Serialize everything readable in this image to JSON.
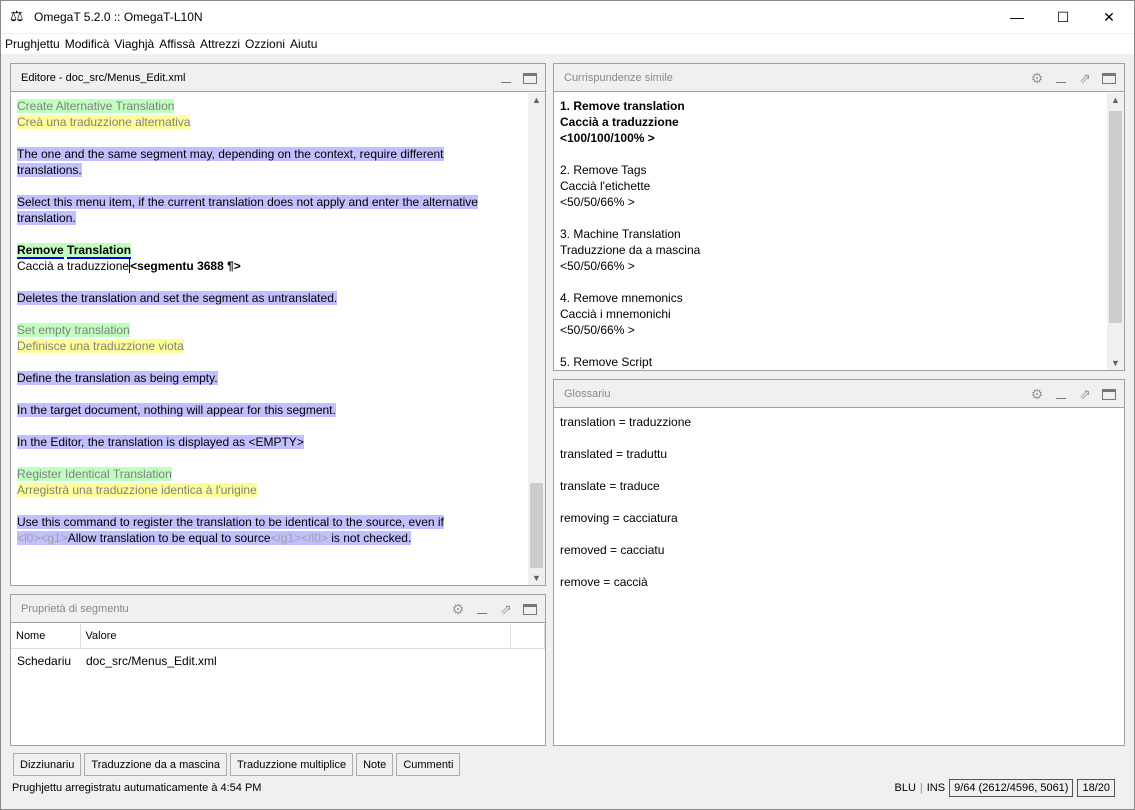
{
  "window": {
    "title": "OmegaT 5.2.0 :: OmegaT-L10N",
    "minimize": "—",
    "maximize": "☐",
    "close": "✕"
  },
  "menu": [
    "Prughjettu",
    "Modificà",
    "Viaghjà",
    "Affissà",
    "Attrezzi",
    "Ozzioni",
    "Aiutu"
  ],
  "editor": {
    "title": "Editore - doc_src/Menus_Edit.xml",
    "lines": [
      [
        {
          "c": "src",
          "t": "Create Alternative Translation"
        }
      ],
      [
        {
          "c": "tgt",
          "t": "Creà una traduzzione alternativa"
        }
      ],
      [],
      [
        {
          "c": "oth",
          "t": "The one and the same segment may, depending on the context, require different"
        }
      ],
      [
        {
          "c": "oth",
          "t": "translations."
        }
      ],
      [],
      [
        {
          "c": "oth",
          "t": "Select this menu item, if the current translation does not apply and enter the alternative"
        }
      ],
      [
        {
          "c": "oth",
          "t": "translation."
        }
      ],
      [],
      [
        {
          "c": "cursrc",
          "t": "Remove"
        },
        {
          "c": "cursrc2",
          "t": "Translation"
        }
      ],
      [
        {
          "c": "",
          "t": "Caccià a traduzzione"
        },
        {
          "c": "cur",
          "t": "<segmentu 3688 ¶>"
        }
      ],
      [],
      [
        {
          "c": "oth",
          "t": "Deletes the translation and set the segment as untranslated."
        }
      ],
      [],
      [
        {
          "c": "src",
          "t": "Set empty translation"
        }
      ],
      [
        {
          "c": "tgt",
          "t": "Definisce una traduzzione viota"
        }
      ],
      [],
      [
        {
          "c": "oth",
          "t": "Define the translation as being empty."
        }
      ],
      [],
      [
        {
          "c": "oth",
          "t": "In the target document, nothing will appear for this segment."
        }
      ],
      [],
      [
        {
          "c": "oth",
          "t": "In the Editor, the translation is displayed as <EMPTY>"
        }
      ],
      [],
      [
        {
          "c": "src",
          "t": "Register Identical Translation"
        }
      ],
      [
        {
          "c": "tgt",
          "t": "Arregistrà una traduzzione identica à l'urigine"
        }
      ],
      [],
      [
        {
          "c": "oth",
          "t": "Use this command to register the translation to be identical to the source, even if"
        }
      ],
      [
        {
          "c": "oth tag",
          "t": "<l0><g1>"
        },
        {
          "c": "oth",
          "t": "Allow translation to be equal to source"
        },
        {
          "c": "oth tag",
          "t": "</g1></l0>"
        },
        {
          "c": "oth",
          "t": " is not checked."
        }
      ]
    ]
  },
  "properties": {
    "title": "Pruprietà di segmentu",
    "columns": [
      "Nome",
      "Valore"
    ],
    "rows": [
      [
        "Schedariu",
        "doc_src/Menus_Edit.xml"
      ]
    ]
  },
  "matches": {
    "title": "Currispundenze simile",
    "lines": [
      {
        "b": true,
        "t": "1. Remove translation"
      },
      {
        "b": true,
        "t": "Caccià a traduzzione"
      },
      {
        "b": true,
        "t": "<100/100/100% >"
      },
      {
        "t": ""
      },
      {
        "t": "2. Remove Tags"
      },
      {
        "t": "Caccià l'etichette"
      },
      {
        "t": "<50/50/66% >"
      },
      {
        "t": ""
      },
      {
        "t": "3. Machine Translation"
      },
      {
        "t": "Traduzzione da a mascina"
      },
      {
        "t": "<50/50/66% >"
      },
      {
        "t": ""
      },
      {
        "t": "4. Remove mnemonics"
      },
      {
        "t": "Caccià i mnemonichi"
      },
      {
        "t": "<50/50/66% >"
      },
      {
        "t": ""
      },
      {
        "t": "5. Remove Script"
      }
    ]
  },
  "glossary": {
    "title": "Glossariu",
    "lines": [
      "translation = traduzzione",
      "",
      "translated = traduttu",
      "",
      "translate = traduce",
      "",
      "removing = cacciatura",
      "",
      "removed = cacciatu",
      "",
      "remove = caccià"
    ]
  },
  "tabs": [
    "Dizziunariu",
    "Traduzzione da a mascina",
    "Traduzzione multiplice",
    "Note",
    "Cummenti"
  ],
  "status": {
    "message": "Prughjettu arregistratu autumaticamente à 4:54 PM",
    "mode": "BLU",
    "sep": "|",
    "ins": "INS",
    "progress": "9/64 (2612/4596, 5061)",
    "segment": "18/20"
  }
}
